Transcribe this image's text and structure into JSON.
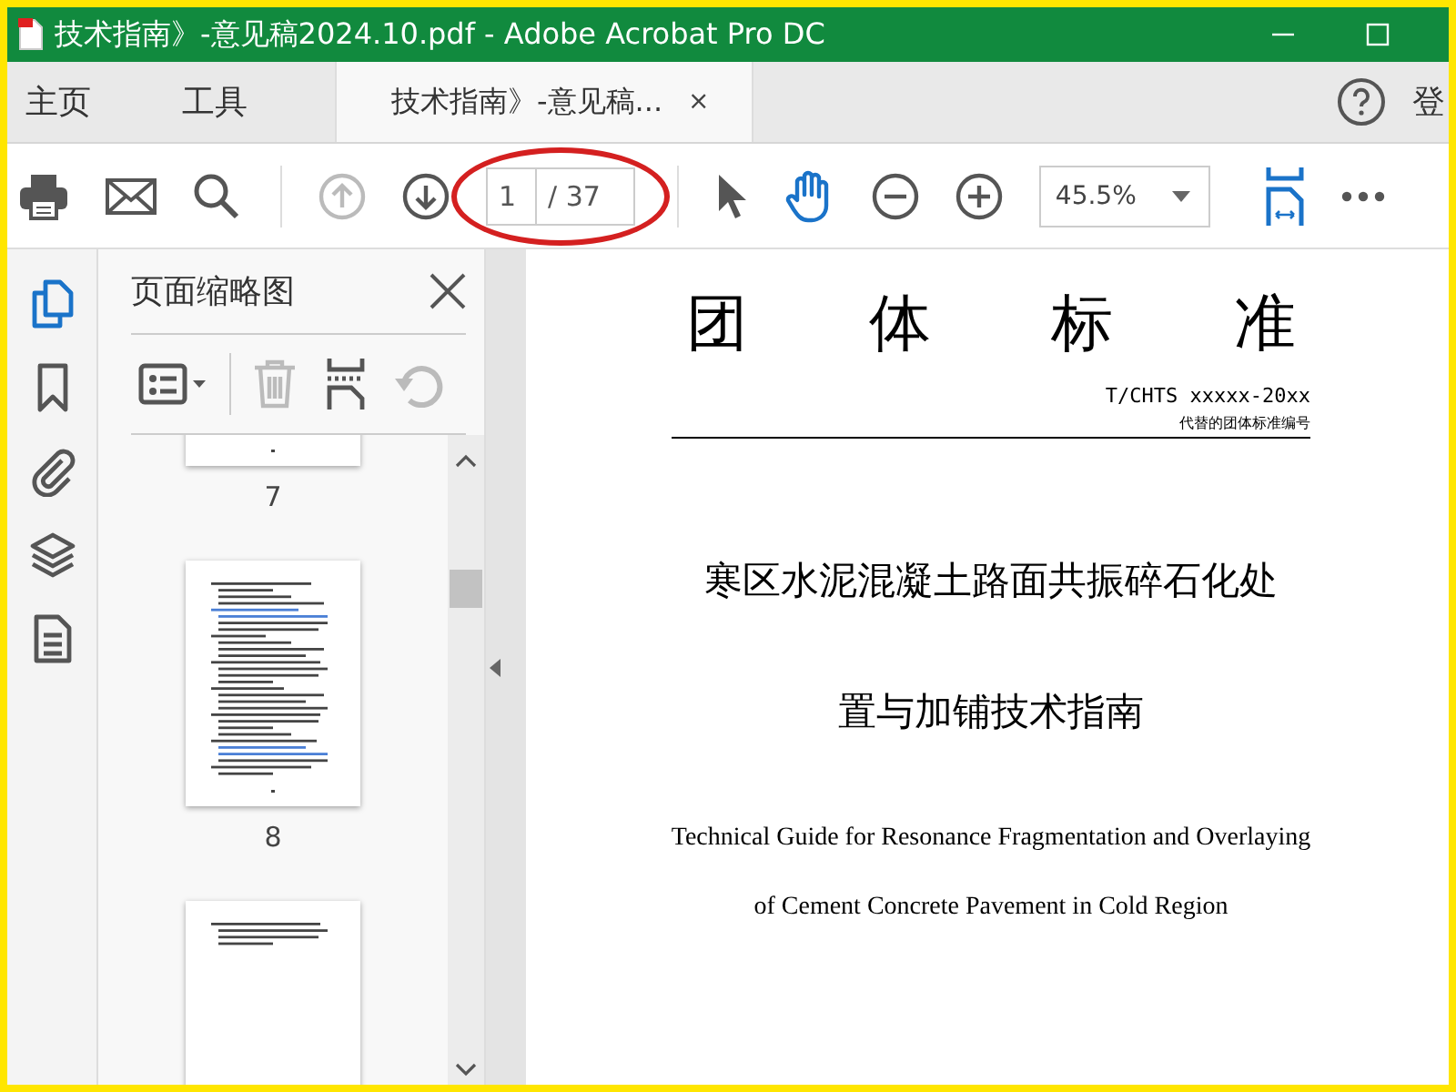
{
  "window": {
    "title": "技术指南》-意见稿2024.10.pdf - Adobe Acrobat Pro DC"
  },
  "tabs": [
    {
      "label": "主页",
      "kind": "home",
      "selected": false
    },
    {
      "label": "工具",
      "kind": "home",
      "selected": false
    },
    {
      "label": "技术指南》-意见稿...",
      "kind": "document",
      "selected": true,
      "close": "×"
    }
  ],
  "account_label": "登",
  "toolbar": {
    "nav": [
      {
        "kind": "up",
        "disabled": true
      },
      {
        "kind": "down",
        "disabled": false
      }
    ],
    "page_current": "1",
    "page_total": "/ 37",
    "tools": [
      {
        "kind": "pointer",
        "selected": false
      },
      {
        "kind": "hand",
        "selected": true
      }
    ],
    "zoom": "45.5%"
  },
  "rail": [
    {
      "kind": "pages",
      "selected": true
    },
    {
      "kind": "bookmark",
      "selected": false
    },
    {
      "kind": "attachment",
      "selected": false
    },
    {
      "kind": "layers",
      "selected": false
    },
    {
      "kind": "document",
      "selected": false
    }
  ],
  "sidebar": {
    "title": "页面缩略图",
    "actions": [
      {
        "kind": "delete",
        "disabled": true
      },
      {
        "kind": "extract",
        "disabled": false
      },
      {
        "kind": "rotate",
        "disabled": true
      }
    ],
    "thumbnails": [
      {
        "kind": "picture",
        "page": "7"
      },
      {
        "kind": "picture",
        "page": "8"
      },
      {
        "kind": "picture"
      }
    ]
  },
  "document": {
    "heading": "团体标准",
    "code": "T/CHTS xxxxx-20xx",
    "code_note": "代替的团体标准编号",
    "title_lines": [
      "寒区水泥混凝土路面共振碎石化处",
      "置与加铺技术指南"
    ],
    "english_lines": [
      "Technical Guide for Resonance Fragmentation and Overlaying",
      "of Cement Concrete Pavement in Cold Region"
    ]
  }
}
